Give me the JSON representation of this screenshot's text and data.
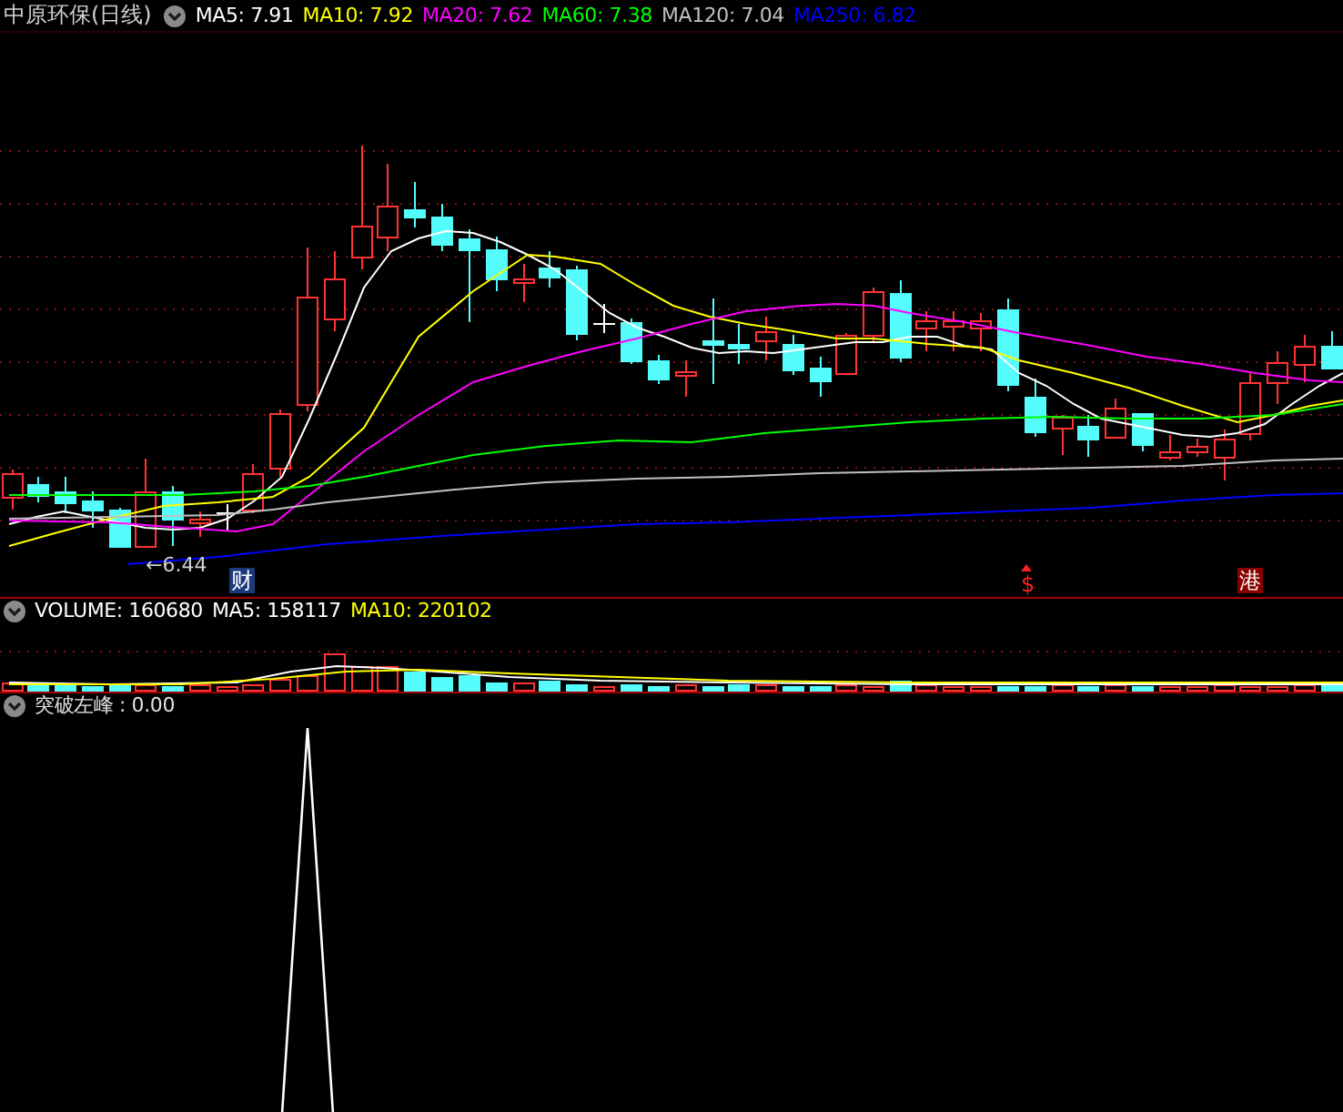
{
  "title": "中原环保(日线)",
  "main_legend": [
    {
      "label": "MA5: 7.91",
      "color": "#ffffff"
    },
    {
      "label": "MA10: 7.92",
      "color": "#ffff00"
    },
    {
      "label": "MA20: 7.62",
      "color": "#ff00ff"
    },
    {
      "label": "MA60: 7.38",
      "color": "#00ff00"
    },
    {
      "label": "MA120: 7.04",
      "color": "#c0c0c0"
    },
    {
      "label": "MA250: 6.82",
      "color": "#0000ff"
    }
  ],
  "price_label": "←6.44",
  "event_markers": [
    {
      "kind": "finance",
      "text": "财"
    },
    {
      "kind": "dollar",
      "text": "$"
    },
    {
      "kind": "hk",
      "text": "港"
    }
  ],
  "volume_legend": [
    {
      "label": "VOLUME: 160680",
      "color": "#ffffff"
    },
    {
      "label": "MA5: 158117",
      "color": "#ffffff"
    },
    {
      "label": "MA10: 220102",
      "color": "#ffff00"
    }
  ],
  "indicator_legend": {
    "label": "突破左峰 : 0.00"
  }
}
